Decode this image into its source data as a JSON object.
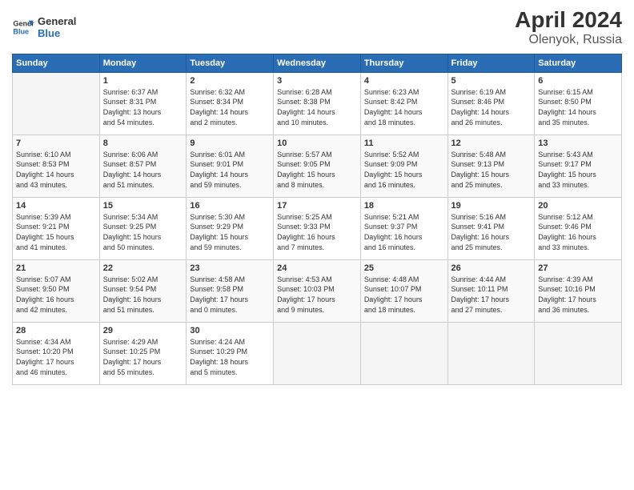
{
  "header": {
    "logo_line1": "General",
    "logo_line2": "Blue",
    "title": "April 2024",
    "subtitle": "Olenyok, Russia"
  },
  "days_of_week": [
    "Sunday",
    "Monday",
    "Tuesday",
    "Wednesday",
    "Thursday",
    "Friday",
    "Saturday"
  ],
  "weeks": [
    [
      {
        "day": "",
        "info": ""
      },
      {
        "day": "1",
        "info": "Sunrise: 6:37 AM\nSunset: 8:31 PM\nDaylight: 13 hours\nand 54 minutes."
      },
      {
        "day": "2",
        "info": "Sunrise: 6:32 AM\nSunset: 8:34 PM\nDaylight: 14 hours\nand 2 minutes."
      },
      {
        "day": "3",
        "info": "Sunrise: 6:28 AM\nSunset: 8:38 PM\nDaylight: 14 hours\nand 10 minutes."
      },
      {
        "day": "4",
        "info": "Sunrise: 6:23 AM\nSunset: 8:42 PM\nDaylight: 14 hours\nand 18 minutes."
      },
      {
        "day": "5",
        "info": "Sunrise: 6:19 AM\nSunset: 8:46 PM\nDaylight: 14 hours\nand 26 minutes."
      },
      {
        "day": "6",
        "info": "Sunrise: 6:15 AM\nSunset: 8:50 PM\nDaylight: 14 hours\nand 35 minutes."
      }
    ],
    [
      {
        "day": "7",
        "info": "Sunrise: 6:10 AM\nSunset: 8:53 PM\nDaylight: 14 hours\nand 43 minutes."
      },
      {
        "day": "8",
        "info": "Sunrise: 6:06 AM\nSunset: 8:57 PM\nDaylight: 14 hours\nand 51 minutes."
      },
      {
        "day": "9",
        "info": "Sunrise: 6:01 AM\nSunset: 9:01 PM\nDaylight: 14 hours\nand 59 minutes."
      },
      {
        "day": "10",
        "info": "Sunrise: 5:57 AM\nSunset: 9:05 PM\nDaylight: 15 hours\nand 8 minutes."
      },
      {
        "day": "11",
        "info": "Sunrise: 5:52 AM\nSunset: 9:09 PM\nDaylight: 15 hours\nand 16 minutes."
      },
      {
        "day": "12",
        "info": "Sunrise: 5:48 AM\nSunset: 9:13 PM\nDaylight: 15 hours\nand 25 minutes."
      },
      {
        "day": "13",
        "info": "Sunrise: 5:43 AM\nSunset: 9:17 PM\nDaylight: 15 hours\nand 33 minutes."
      }
    ],
    [
      {
        "day": "14",
        "info": "Sunrise: 5:39 AM\nSunset: 9:21 PM\nDaylight: 15 hours\nand 41 minutes."
      },
      {
        "day": "15",
        "info": "Sunrise: 5:34 AM\nSunset: 9:25 PM\nDaylight: 15 hours\nand 50 minutes."
      },
      {
        "day": "16",
        "info": "Sunrise: 5:30 AM\nSunset: 9:29 PM\nDaylight: 15 hours\nand 59 minutes."
      },
      {
        "day": "17",
        "info": "Sunrise: 5:25 AM\nSunset: 9:33 PM\nDaylight: 16 hours\nand 7 minutes."
      },
      {
        "day": "18",
        "info": "Sunrise: 5:21 AM\nSunset: 9:37 PM\nDaylight: 16 hours\nand 16 minutes."
      },
      {
        "day": "19",
        "info": "Sunrise: 5:16 AM\nSunset: 9:41 PM\nDaylight: 16 hours\nand 25 minutes."
      },
      {
        "day": "20",
        "info": "Sunrise: 5:12 AM\nSunset: 9:46 PM\nDaylight: 16 hours\nand 33 minutes."
      }
    ],
    [
      {
        "day": "21",
        "info": "Sunrise: 5:07 AM\nSunset: 9:50 PM\nDaylight: 16 hours\nand 42 minutes."
      },
      {
        "day": "22",
        "info": "Sunrise: 5:02 AM\nSunset: 9:54 PM\nDaylight: 16 hours\nand 51 minutes."
      },
      {
        "day": "23",
        "info": "Sunrise: 4:58 AM\nSunset: 9:58 PM\nDaylight: 17 hours\nand 0 minutes."
      },
      {
        "day": "24",
        "info": "Sunrise: 4:53 AM\nSunset: 10:03 PM\nDaylight: 17 hours\nand 9 minutes."
      },
      {
        "day": "25",
        "info": "Sunrise: 4:48 AM\nSunset: 10:07 PM\nDaylight: 17 hours\nand 18 minutes."
      },
      {
        "day": "26",
        "info": "Sunrise: 4:44 AM\nSunset: 10:11 PM\nDaylight: 17 hours\nand 27 minutes."
      },
      {
        "day": "27",
        "info": "Sunrise: 4:39 AM\nSunset: 10:16 PM\nDaylight: 17 hours\nand 36 minutes."
      }
    ],
    [
      {
        "day": "28",
        "info": "Sunrise: 4:34 AM\nSunset: 10:20 PM\nDaylight: 17 hours\nand 46 minutes."
      },
      {
        "day": "29",
        "info": "Sunrise: 4:29 AM\nSunset: 10:25 PM\nDaylight: 17 hours\nand 55 minutes."
      },
      {
        "day": "30",
        "info": "Sunrise: 4:24 AM\nSunset: 10:29 PM\nDaylight: 18 hours\nand 5 minutes."
      },
      {
        "day": "",
        "info": ""
      },
      {
        "day": "",
        "info": ""
      },
      {
        "day": "",
        "info": ""
      },
      {
        "day": "",
        "info": ""
      }
    ]
  ]
}
